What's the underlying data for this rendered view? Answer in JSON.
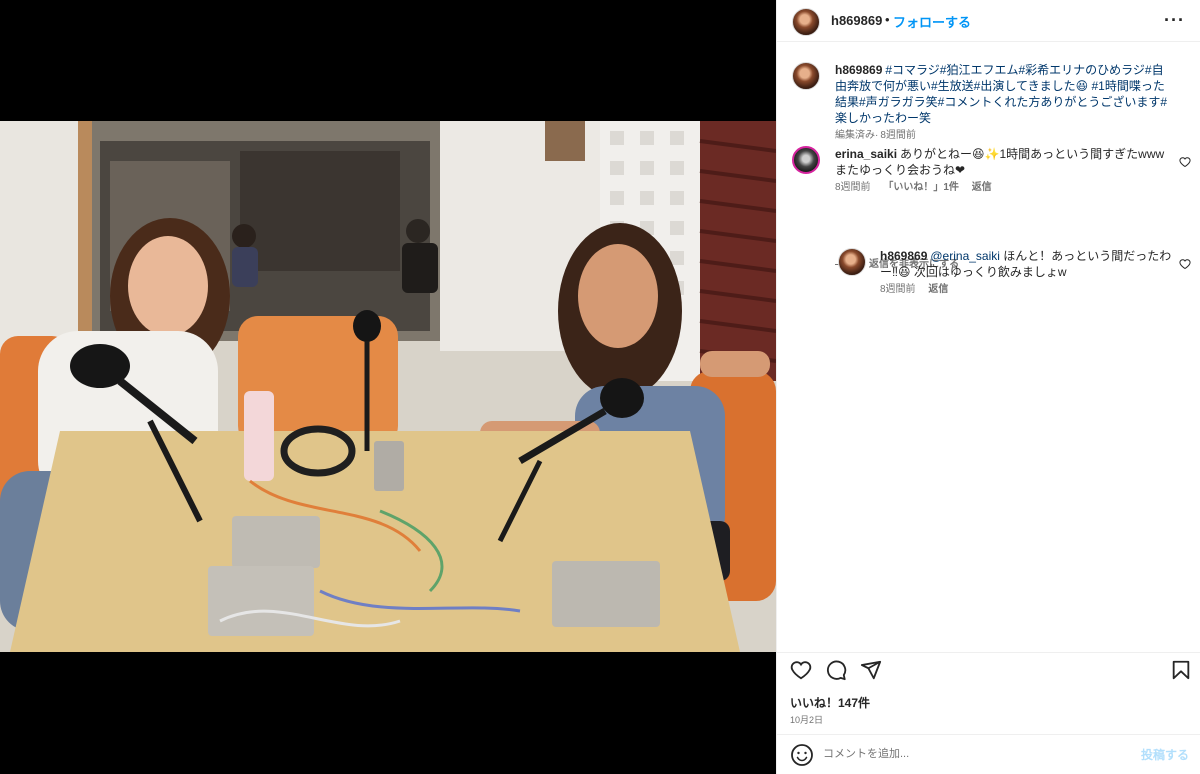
{
  "post": {
    "author": "h869869",
    "dot": "•",
    "follow_label": "フォローする",
    "more_label": "···",
    "icons": {
      "more": "more-horizontal-icon",
      "like": "heart-icon",
      "comment": "comment-bubble-icon",
      "share": "paper-plane-icon",
      "save": "bookmark-icon",
      "emoji": "smiley-icon"
    }
  },
  "caption": {
    "username": "h869869",
    "text": "#コマラジ#狛江エフエム#彩希エリナのひめラジ#自由奔放で何が悪い#生放送#出演してきました😆 #1時間喋った結果#声ガラガラ笑#コメントくれた方ありがとうございます#楽しかったわー笑",
    "meta": [
      "編集済み",
      "8週間前"
    ]
  },
  "comments": [
    {
      "username": "erina_saiki",
      "text": "ありがとねー😆✨1時間あっという間すぎたwwwまたゆっくり会おうね❤",
      "time": "8週間前",
      "likes": "「いいね！」1件",
      "reply": "返信"
    }
  ],
  "hide_replies_label": "返信を非表示にする",
  "replies": [
    {
      "username": "h869869",
      "mention": "@erina_saiki",
      "text": "ほんと！あっという間だったわー‼😆 次回はゆっくり飲みましょw",
      "time": "8週間前",
      "reply": "返信"
    }
  ],
  "footer": {
    "likes_count": "いいね！147件",
    "date": "10月2日",
    "comment_placeholder": "コメントを追加...",
    "post_label": "投稿する"
  },
  "colors": {
    "link_blue": "#0095f6",
    "hashtag": "#00376b",
    "muted": "#737373",
    "post_disabled": "#b2dffc"
  }
}
